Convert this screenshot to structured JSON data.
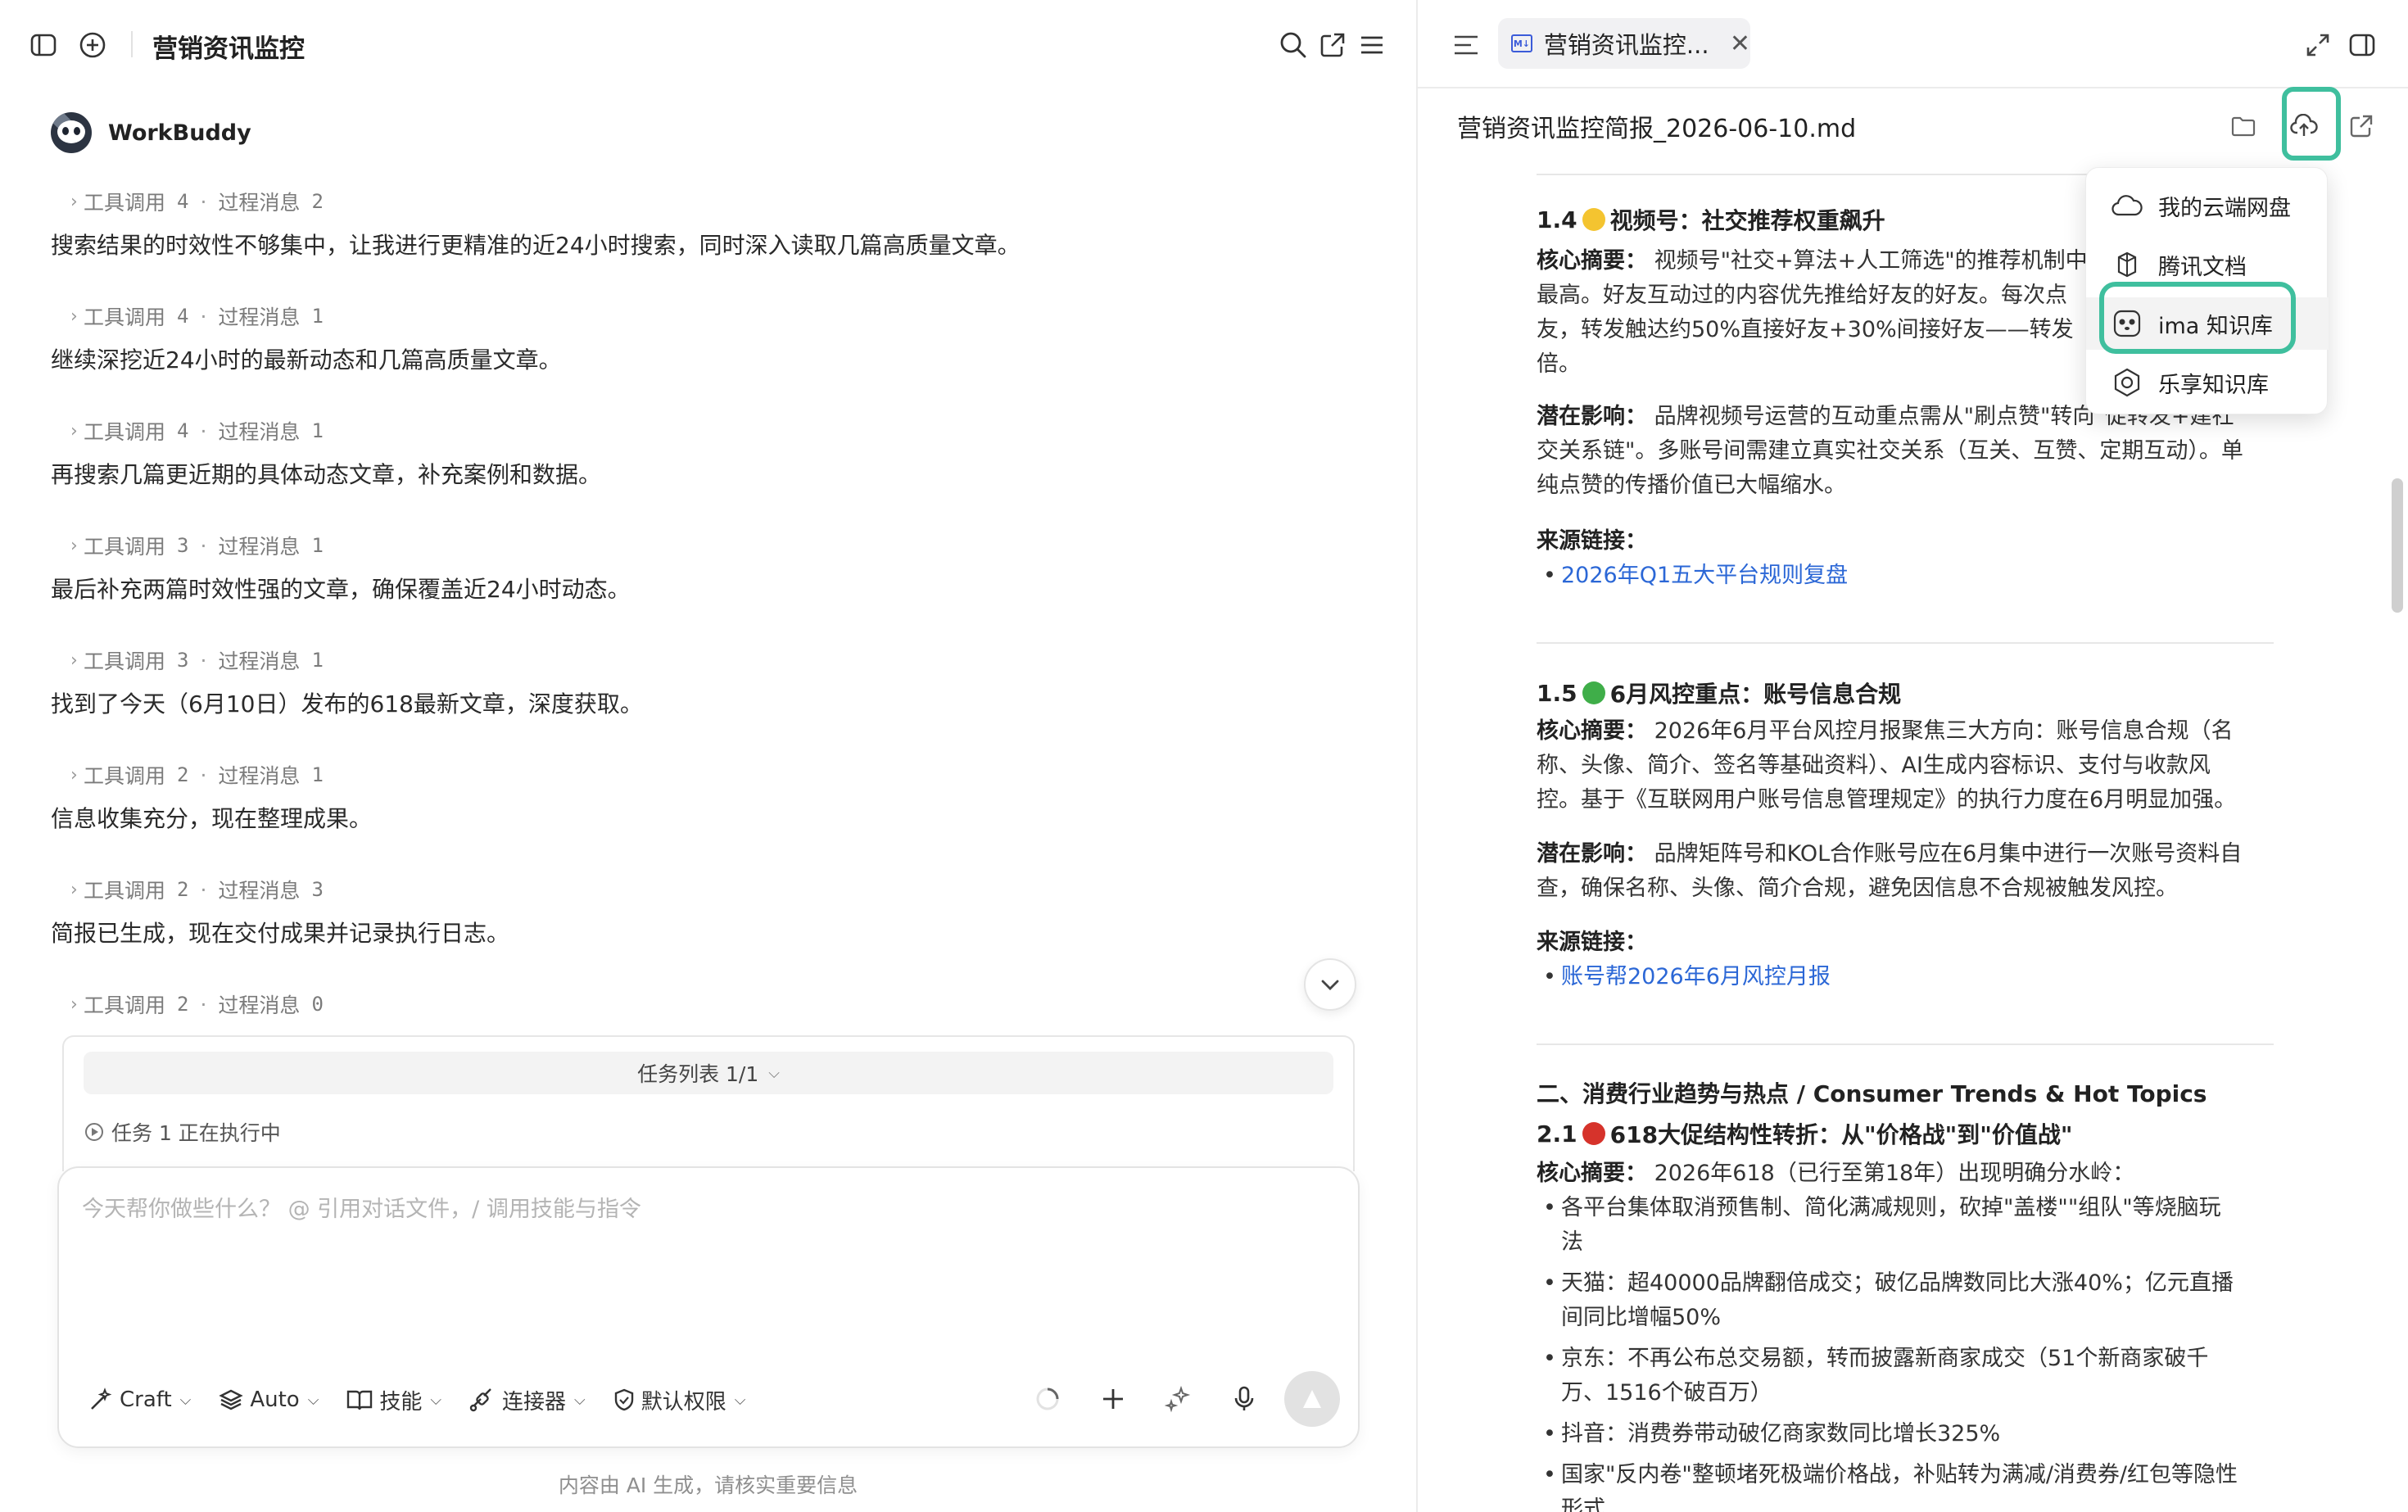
{
  "left": {
    "title": "营销资讯监控",
    "agent_name": "WorkBuddy",
    "label_tools": "工具调用",
    "label_process": "过程消息",
    "messages": [
      {
        "tools": "4",
        "process": "2",
        "text": "搜索结果的时效性不够集中，让我进行更精准的近24小时搜索，同时深入读取几篇高质量文章。"
      },
      {
        "tools": "4",
        "process": "1",
        "text": "继续深挖近24小时的最新动态和几篇高质量文章。"
      },
      {
        "tools": "4",
        "process": "1",
        "text": "再搜索几篇更近期的具体动态文章，补充案例和数据。"
      },
      {
        "tools": "3",
        "process": "1",
        "text": "最后补充两篇时效性强的文章，确保覆盖近24小时动态。"
      },
      {
        "tools": "3",
        "process": "1",
        "text": "找到了今天（6月10日）发布的618最新文章，深度获取。"
      },
      {
        "tools": "2",
        "process": "1",
        "text": "信息收集充分，现在整理成果。"
      },
      {
        "tools": "2",
        "process": "3",
        "text": "简报已生成，现在交付成果并记录执行日志。"
      },
      {
        "tools": "2",
        "process": "0",
        "text": ""
      }
    ],
    "task_list": "任务列表 1/1",
    "task_item": "任务 1 正在执行中",
    "composer_placeholder": "今天帮你做些什么？ @ 引用对话文件，/ 调用技能与指令",
    "tools": {
      "craft": "Craft",
      "auto": "Auto",
      "skills": "技能",
      "connectors": "连接器",
      "permission": "默认权限"
    },
    "footer": "内容由 AI 生成，请核实重要信息"
  },
  "right": {
    "tab_title": "营销资讯监控...",
    "md_badge": "M↓",
    "doc_title": "营销资讯监控简报_2026-06-10.md",
    "menu": [
      "我的云端网盘",
      "腾讯文档",
      "ima 知识库",
      "乐享知识库"
    ],
    "doc": {
      "s14_title_pre": "1.4",
      "s14_title": "视频号：社交推荐权重飙升",
      "s14_core_label": "核心摘要：",
      "s14_core_l1": "视频号\"社交+算法+人工筛选\"的推荐机制中",
      "s14_core_l2": "最高。好友互动过的内容优先推给好友的好友。每次点",
      "s14_core_l3": "友，转发触达约50%直接好友+30%间接好友——转发",
      "s14_core_l4": "倍。",
      "s14_impact_label": "潜在影响：",
      "s14_impact_l1": "品牌视频号运营的互动重点需从\"刷点赞\"转向\"促转发+建社",
      "s14_impact_l2": "交关系链\"。多账号间需建立真实社交关系（互关、互赞、定期互动）。单",
      "s14_impact_l3": "纯点赞的传播价值已大幅缩水。",
      "source_label": "来源链接：",
      "s14_link": "2026年Q1五大平台规则复盘",
      "s15_title_pre": "1.5",
      "s15_title": "6月风控重点：账号信息合规",
      "s15_core_label": "核心摘要：",
      "s15_core_l1": "2026年6月平台风控月报聚焦三大方向：账号信息合规（名",
      "s15_core_l2": "称、头像、简介、签名等基础资料）、AI生成内容标识、支付与收款风",
      "s15_core_l3": "控。基于《互联网用户账号信息管理规定》的执行力度在6月明显加强。",
      "s15_impact_label": "潜在影响：",
      "s15_impact_l1": "品牌矩阵号和KOL合作账号应在6月集中进行一次账号资料自",
      "s15_impact_l2": "查，确保名称、头像、简介合规，避免因信息不合规被触发风控。",
      "s15_link": "账号帮2026年6月风控月报",
      "sec2_title": "二、消费行业趋势与热点 / Consumer Trends & Hot Topics",
      "s21_title_pre": "2.1",
      "s21_title": "618大促结构性转折：从\"价格战\"到\"价值战\"",
      "s21_core_label": "核心摘要：",
      "s21_core_text": "2026年618（已行至第18年）出现明确分水岭：",
      "bullets": [
        {
          "l1": "各平台集体取消预售制、简化满减规则，砍掉\"盖楼\"\"组队\"等烧脑玩",
          "l2": "法"
        },
        {
          "l1": "天猫：超40000品牌翻倍成交；破亿品牌数同比大涨40%；亿元直播",
          "l2": "间同比增幅50%"
        },
        {
          "l1": "京东：不再公布总交易额，转而披露新商家成交（51个新商家破千",
          "l2": "万、1516个破百万）"
        },
        {
          "l1": "抖音：消费券带动破亿商家数同比增长325%",
          "l2": ""
        },
        {
          "l1": "国家\"反内卷\"整顿堵死极端价格战，补贴转为满减/消费券/红包等隐性",
          "l2": "形式"
        }
      ]
    }
  },
  "colors": {
    "highlight": "#3fbf9e",
    "link": "#2b67d6",
    "yellow": "#f4c430",
    "green": "#3fae49",
    "red": "#d6332b"
  }
}
